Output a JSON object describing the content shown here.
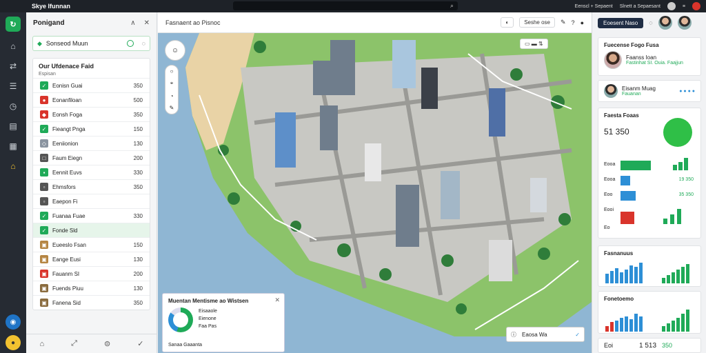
{
  "topbar": {
    "title": "Skye Ifunnan",
    "right_items": [
      "Eenscl + Sepaent",
      "Slnett a Sepaesant"
    ]
  },
  "rail": {
    "logo_glyph": "↻"
  },
  "left": {
    "title": "Ponigand",
    "select_label": "Sonseod Muun",
    "section_title": "Our Ufdenace Faid",
    "section_sub": "Espisan",
    "items": [
      {
        "label": "Eonisn Guai",
        "value": "350",
        "color": "#1faa58",
        "glyph": "✓"
      },
      {
        "label": "Eonanfiloan",
        "value": "500",
        "color": "#d9342b",
        "glyph": "●"
      },
      {
        "label": "Eonsh Foga",
        "value": "350",
        "color": "#d9342b",
        "glyph": "◆"
      },
      {
        "label": "Fieangt Pnga",
        "value": "150",
        "color": "#1faa58",
        "glyph": "✓"
      },
      {
        "label": "Eeniionion",
        "value": "130",
        "color": "#8a94a0",
        "glyph": "◇"
      },
      {
        "label": "Faum Eiegn",
        "value": "200",
        "color": "#555",
        "glyph": "□"
      },
      {
        "label": "Eennit Euvs",
        "value": "330",
        "color": "#1faa58",
        "glyph": "▪"
      },
      {
        "label": "Ehmsfors",
        "value": "350",
        "color": "#555",
        "glyph": "▫"
      },
      {
        "label": "Eaepon Fi",
        "value": "",
        "color": "#555",
        "glyph": "▫"
      },
      {
        "label": "Fuanaa Fuae",
        "value": "330",
        "color": "#1faa58",
        "glyph": "✓"
      },
      {
        "label": "Fonde Sld",
        "value": "",
        "color": "#1faa58",
        "glyph": "✓"
      },
      {
        "label": "Eueeslo Fsan",
        "value": "150",
        "color": "#b58542",
        "glyph": "▣"
      },
      {
        "label": "Eange Eusi",
        "value": "130",
        "color": "#b58542",
        "glyph": "▣"
      },
      {
        "label": "Fauanm SI",
        "value": "200",
        "color": "#d9342b",
        "glyph": "▣"
      },
      {
        "label": "Fuends Piuu",
        "value": "130",
        "color": "#8a6b3e",
        "glyph": "▣"
      },
      {
        "label": "Fanena Sid",
        "value": "350",
        "color": "#8a6b3e",
        "glyph": "▣"
      }
    ]
  },
  "map": {
    "header_title": "Fasnaent ao Pisnoc",
    "tool_label": "Seshe ose",
    "popup": {
      "title": "Muentan Mentisme ao Wistsen",
      "l1": "Eisaaole",
      "l2": "Eienone",
      "l3": "Faa Pas",
      "foot": "Sanaa Gaaanta"
    },
    "bottom_chip": "Eaosa Wa"
  },
  "right": {
    "tab_label": "Eoesent Naso",
    "card1": {
      "title": "Fuecense Fogo Fusa",
      "name": "Faanss Ioan",
      "sub": "Fastinhat SI. Ouia. Faajjun"
    },
    "card2": {
      "name": "Eisanm Muag",
      "sub": "Fauanan"
    },
    "card3": {
      "title": "Faesta Foaas",
      "value": "51 350",
      "rows": [
        "Eooa",
        "Eooa",
        "Eoo",
        "Eooi",
        "Eo"
      ],
      "vals": [
        "",
        "19 350",
        "35 350",
        "",
        ""
      ]
    },
    "card4": {
      "title": "Fasnanuus"
    },
    "card5": {
      "title": "Fonetoemo"
    },
    "card6": {
      "label": "Eoi",
      "value": "1 513",
      "value2": "350"
    }
  }
}
